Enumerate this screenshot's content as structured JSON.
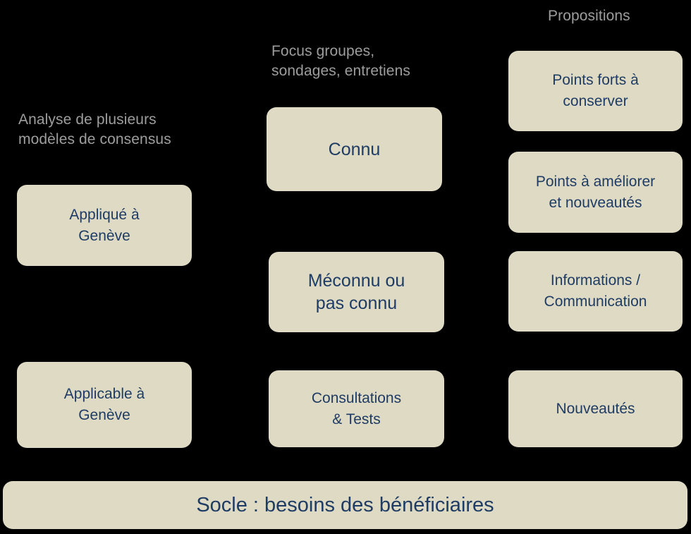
{
  "diagram": {
    "background_color": "#000000",
    "card_color": "#dedac4",
    "card_text_color": "#1f3c64",
    "header_text_color": "#9d9d9d",
    "columns": [
      {
        "id": "column-left",
        "header": "Analyse de plusieurs\nmodèles de consensus",
        "cards": [
          {
            "id": "card-applique-a-geneve",
            "label": "Appliqué à\nGenève"
          },
          {
            "id": "card-applicable-a-geneve",
            "label": "Applicable à\nGenève"
          }
        ]
      },
      {
        "id": "column-middle",
        "header": "Focus groupes,\nsondages, entretiens",
        "cards": [
          {
            "id": "card-connu",
            "label": "Connu"
          },
          {
            "id": "card-meconnu-ou-pas-connu",
            "label": "Méconnu ou\npas connu"
          },
          {
            "id": "card-consultations-tests",
            "label": "Consultations\n& Tests"
          }
        ]
      },
      {
        "id": "column-right",
        "header": "Propositions",
        "cards": [
          {
            "id": "card-points-forts-a-conserver",
            "label": "Points forts à\nconserver"
          },
          {
            "id": "card-points-a-ameliorer",
            "label": "Points à améliorer\net nouveautés"
          },
          {
            "id": "card-informations-communication",
            "label": "Informations /\nCommunication"
          },
          {
            "id": "card-nouveautes",
            "label": "Nouveautés"
          }
        ]
      }
    ],
    "footer": {
      "id": "footer-socle",
      "label": "Socle : besoins  des bénéficiaires"
    }
  }
}
